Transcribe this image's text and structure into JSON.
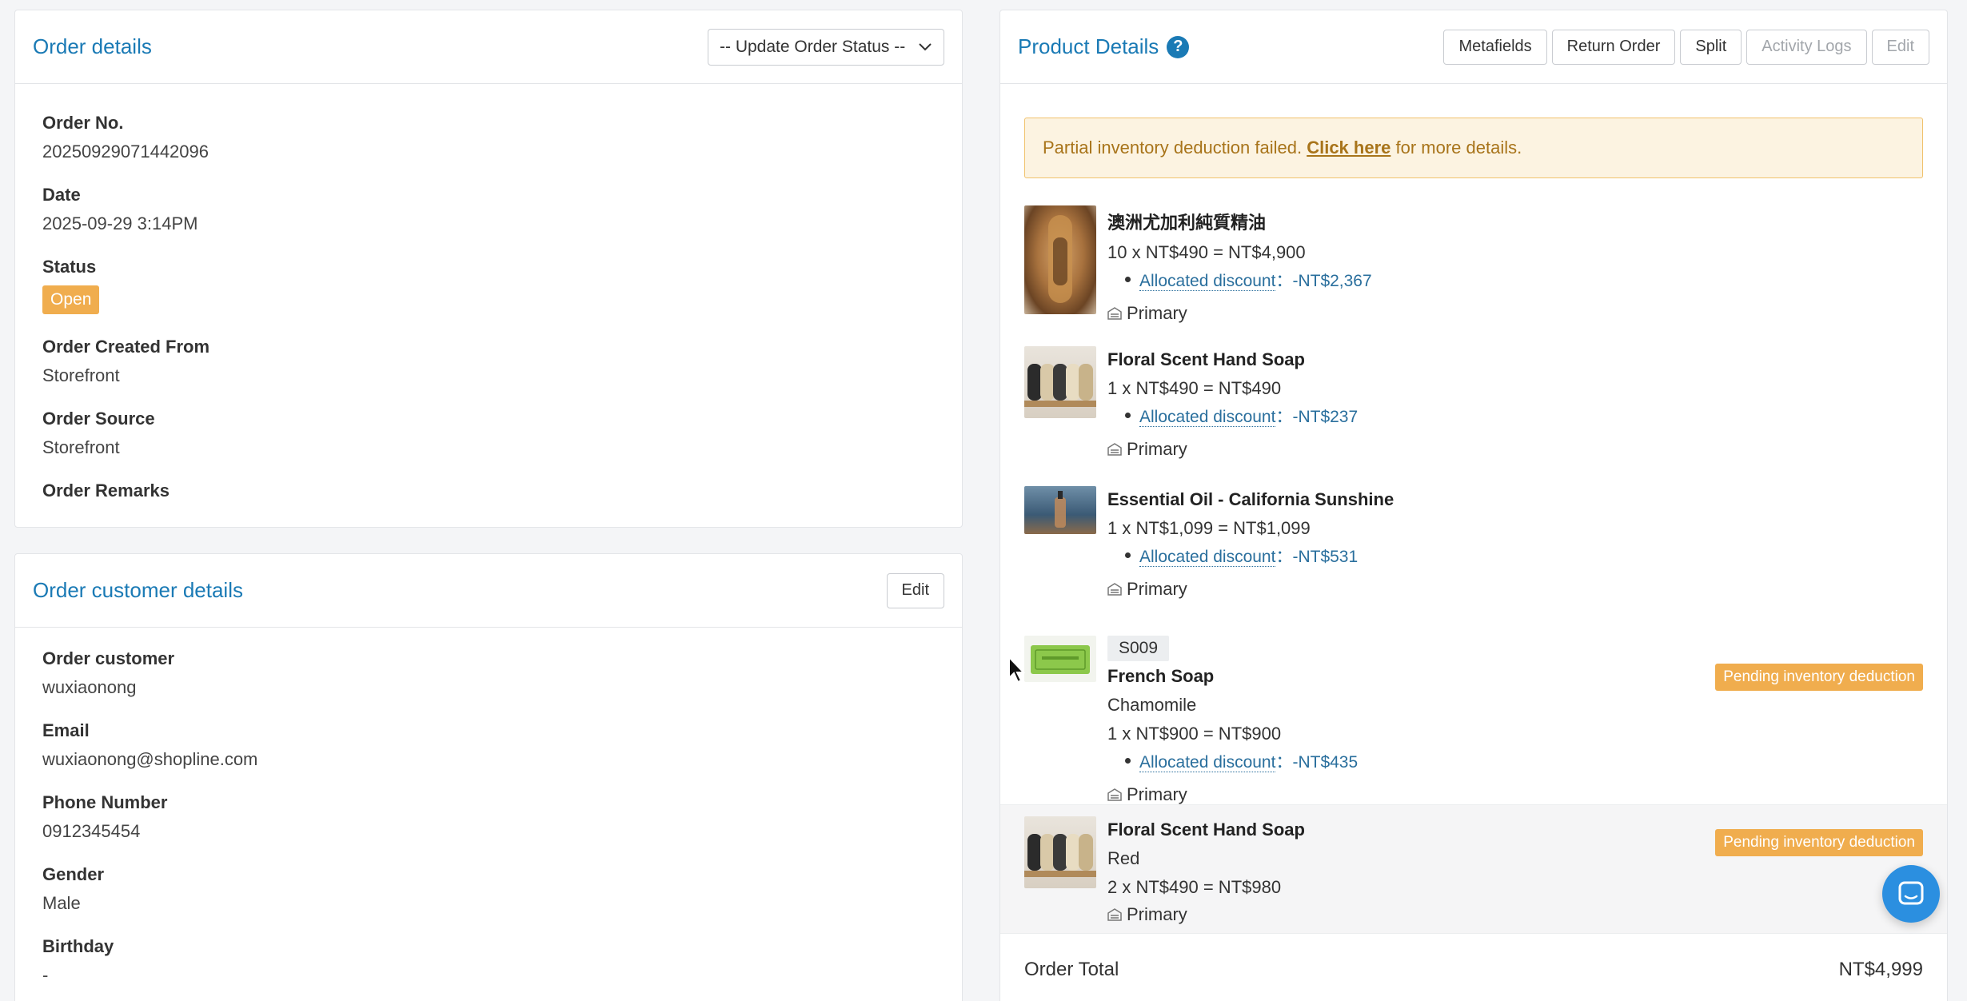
{
  "order_details": {
    "title": "Order details",
    "status_select": "-- Update Order Status --",
    "fields": {
      "order_no_label": "Order No.",
      "order_no": "20250929071442096",
      "date_label": "Date",
      "date": "2025-09-29 3:14PM",
      "status_label": "Status",
      "status": "Open",
      "created_from_label": "Order Created From",
      "created_from": "Storefront",
      "source_label": "Order Source",
      "source": "Storefront",
      "remarks_label": "Order Remarks"
    }
  },
  "customer_details": {
    "title": "Order customer details",
    "edit_label": "Edit",
    "fields": {
      "customer_label": "Order customer",
      "customer": "wuxiaonong",
      "email_label": "Email",
      "email": "wuxiaonong@shopline.com",
      "phone_label": "Phone Number",
      "phone": "0912345454",
      "gender_label": "Gender",
      "gender": "Male",
      "birthday_label": "Birthday",
      "birthday": "-"
    }
  },
  "product_details": {
    "title": "Product Details",
    "help_icon": "?",
    "buttons": {
      "metafields": "Metafields",
      "return_order": "Return Order",
      "split": "Split",
      "activity_logs": "Activity Logs",
      "edit": "Edit"
    },
    "alert": {
      "before": "Partial inventory deduction failed. ",
      "link": "Click here",
      "after": " for more details."
    },
    "items": [
      {
        "name": "澳洲尤加利純質精油",
        "price_line": "10 x NT$490 = NT$4,900",
        "discount_label": "Allocated discount",
        "discount_value": "：-NT$2,367",
        "warehouse": "Primary"
      },
      {
        "name": "Floral Scent Hand Soap",
        "price_line": "1 x NT$490 = NT$490",
        "discount_label": "Allocated discount",
        "discount_value": "：-NT$237",
        "warehouse": "Primary"
      },
      {
        "name": "Essential Oil - California Sunshine",
        "price_line": "1 x NT$1,099 = NT$1,099",
        "discount_label": "Allocated discount",
        "discount_value": "：-NT$531",
        "warehouse": "Primary"
      },
      {
        "sku": "S009",
        "name": "French Soap",
        "variant": "Chamomile",
        "price_line": "1 x NT$900 = NT$900",
        "discount_label": "Allocated discount",
        "discount_value": "：-NT$435",
        "warehouse": "Primary",
        "badge": "Pending inventory deduction"
      },
      {
        "name": "Floral Scent Hand Soap",
        "variant": "Red",
        "price_line": "2 x NT$490 = NT$980",
        "warehouse": "Primary",
        "badge": "Pending inventory deduction"
      }
    ],
    "total_label": "Order Total",
    "total_value": "NT$4,999"
  },
  "colors": {
    "accent": "#1a7ab5",
    "status_orange": "#f0ad4e",
    "alert_bg": "#fcf3e1",
    "chat_blue": "#2b8fe0"
  }
}
